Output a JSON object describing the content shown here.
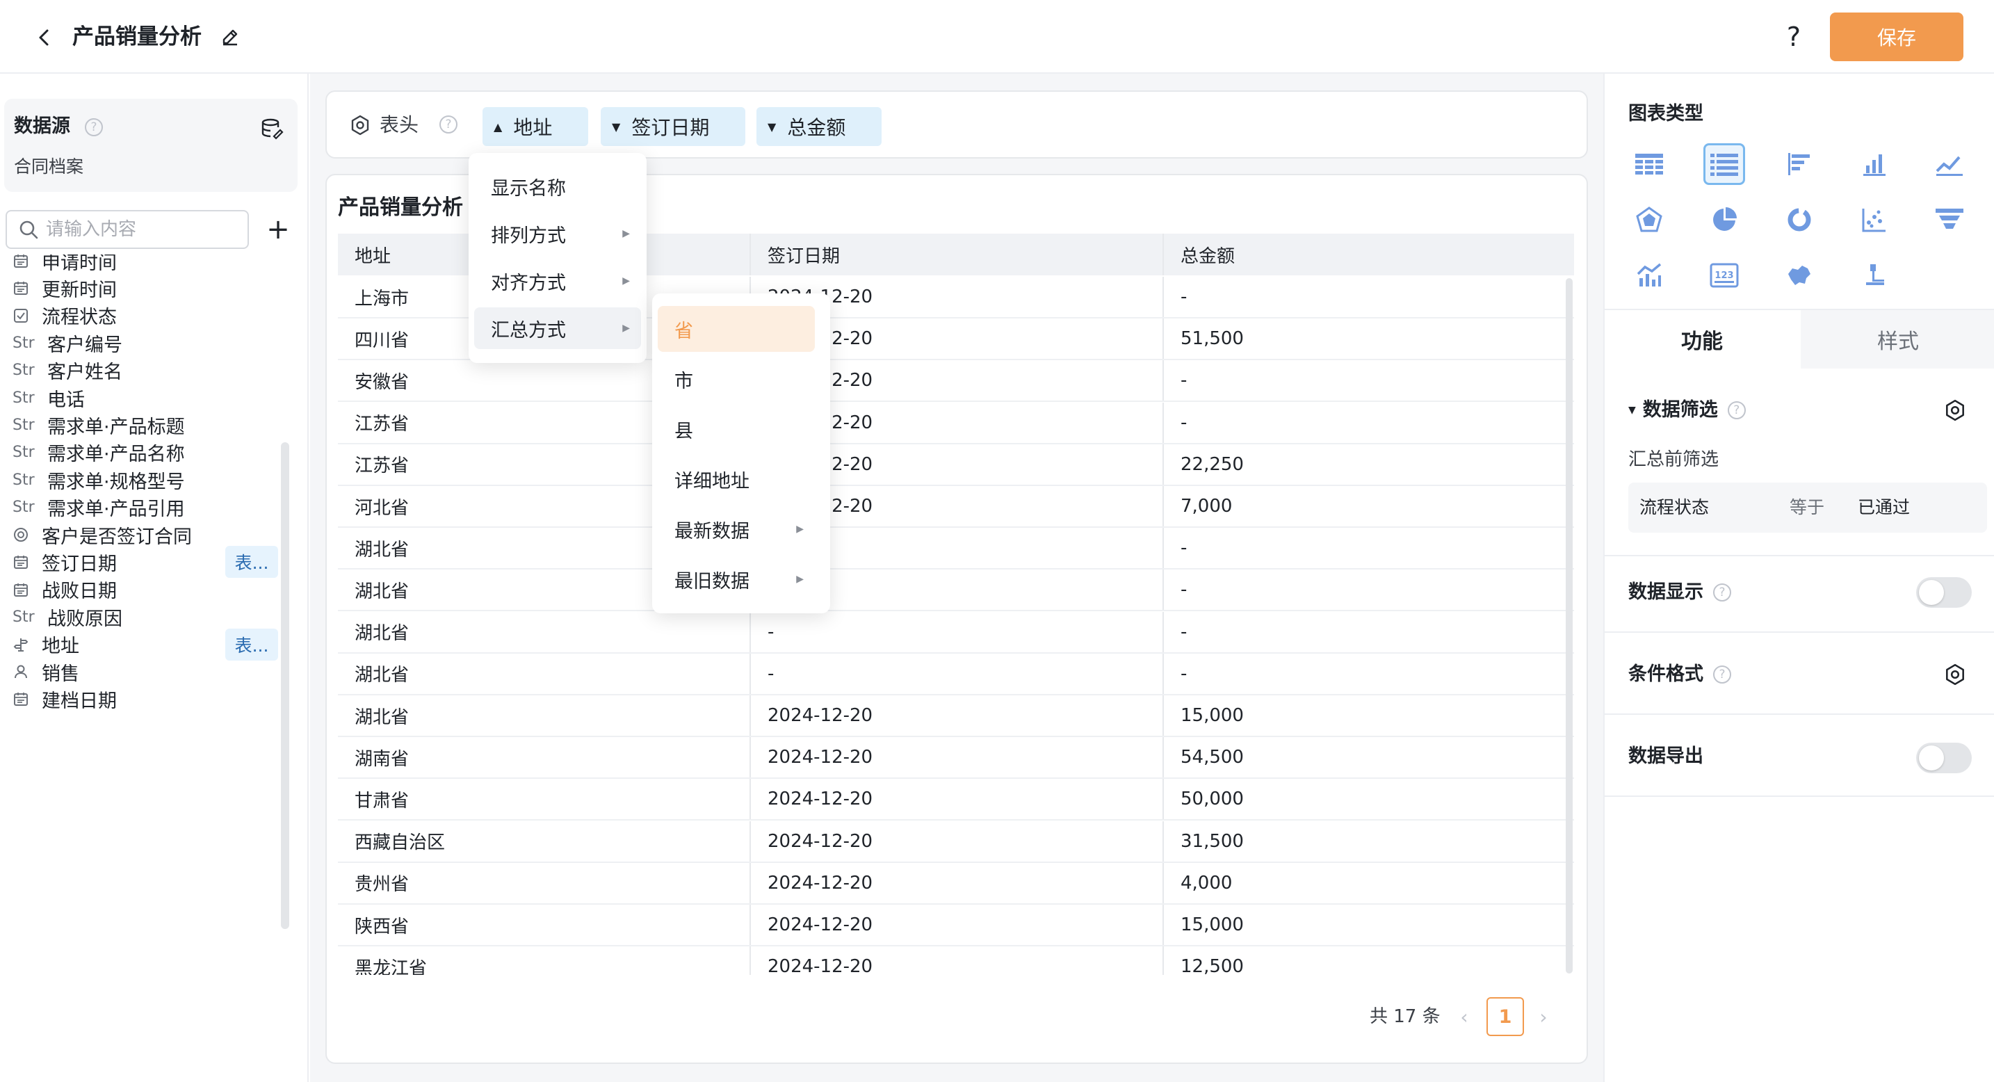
{
  "header": {
    "title": "产品销量分析",
    "help": "?",
    "save_label": "保存"
  },
  "datasource": {
    "title": "数据源",
    "help": "?",
    "name": "合同档案",
    "search_placeholder": "请输入内容",
    "add": "+"
  },
  "fields": [
    {
      "icon": "calendar-icon",
      "label": "申请时间",
      "type": "date"
    },
    {
      "icon": "calendar-icon",
      "label": "更新时间",
      "type": "date"
    },
    {
      "icon": "checkbox-icon",
      "label": "流程状态",
      "type": "check"
    },
    {
      "icon": "Str",
      "label": "客户编号",
      "type": "str"
    },
    {
      "icon": "Str",
      "label": "客户姓名",
      "type": "str"
    },
    {
      "icon": "Str",
      "label": "电话",
      "type": "str"
    },
    {
      "icon": "Str",
      "label": "需求单·产品标题",
      "type": "str"
    },
    {
      "icon": "Str",
      "label": "需求单·产品名称",
      "type": "str"
    },
    {
      "icon": "Str",
      "label": "需求单·规格型号",
      "type": "str"
    },
    {
      "icon": "Str",
      "label": "需求单·产品引用",
      "type": "str"
    },
    {
      "icon": "radio-icon",
      "label": "客户是否签订合同",
      "type": "radio"
    },
    {
      "icon": "calendar-icon",
      "label": "签订日期",
      "type": "date",
      "tag": "表..."
    },
    {
      "icon": "calendar-icon",
      "label": "战败日期",
      "type": "date"
    },
    {
      "icon": "Str",
      "label": "战败原因",
      "type": "str"
    },
    {
      "icon": "address-icon",
      "label": "地址",
      "type": "addr",
      "tag": "表..."
    },
    {
      "icon": "user-icon",
      "label": "销售",
      "type": "user"
    },
    {
      "icon": "calendar-icon",
      "label": "建档日期",
      "type": "date"
    }
  ],
  "header_bar": {
    "label": "表头",
    "help": "?",
    "chips": [
      {
        "label": "地址",
        "arrow": "▲"
      },
      {
        "label": "签订日期",
        "arrow": "▼"
      },
      {
        "label": "总金额",
        "arrow": "▼"
      }
    ]
  },
  "table": {
    "title": "产品销量分析",
    "columns": [
      "地址",
      "签订日期",
      "总金额"
    ],
    "rows": [
      [
        "上海市",
        "2024-12-20",
        "-"
      ],
      [
        "四川省",
        "2024-12-20",
        "51,500"
      ],
      [
        "安徽省",
        "2024-12-20",
        "-"
      ],
      [
        "江苏省",
        "2024-12-20",
        "-"
      ],
      [
        "江苏省",
        "2024-12-20",
        "22,250"
      ],
      [
        "河北省",
        "2024-12-20",
        "7,000"
      ],
      [
        "湖北省",
        "",
        "-"
      ],
      [
        "湖北省",
        "",
        "-"
      ],
      [
        "湖北省",
        "-",
        "-"
      ],
      [
        "湖北省",
        "-",
        "-"
      ],
      [
        "湖北省",
        "2024-12-20",
        "15,000"
      ],
      [
        "湖南省",
        "2024-12-20",
        "54,500"
      ],
      [
        "甘肃省",
        "2024-12-20",
        "50,000"
      ],
      [
        "西藏自治区",
        "2024-12-20",
        "31,500"
      ],
      [
        "贵州省",
        "2024-12-20",
        "4,000"
      ],
      [
        "陕西省",
        "2024-12-20",
        "15,000"
      ],
      [
        "黑龙江省",
        "2024-12-20",
        "12,500"
      ]
    ],
    "total": "共 17 条",
    "page": "1"
  },
  "menu1": [
    {
      "label": "显示名称",
      "sub": false
    },
    {
      "label": "排列方式",
      "sub": true
    },
    {
      "label": "对齐方式",
      "sub": true
    },
    {
      "label": "汇总方式",
      "sub": true
    }
  ],
  "menu2": [
    {
      "label": "省",
      "sub": false,
      "selected": true
    },
    {
      "label": "市",
      "sub": false
    },
    {
      "label": "县",
      "sub": false
    },
    {
      "label": "详细地址",
      "sub": false
    },
    {
      "label": "最新数据",
      "sub": true
    },
    {
      "label": "最旧数据",
      "sub": true
    }
  ],
  "right": {
    "chart_type_title": "图表类型",
    "chart_icons": [
      "table-icon",
      "detail-table-icon",
      "bar-horizontal-icon",
      "bar-vertical-icon",
      "line-icon",
      "radar-icon",
      "pie-icon",
      "donut-icon",
      "scatter-icon",
      "funnel-icon",
      "combo-icon",
      "number-card-icon",
      "map-icon",
      "tree-icon"
    ],
    "tab_function": "功能",
    "tab_style": "样式",
    "filter_section": "数据筛选",
    "filter_sub": "汇总前筛选",
    "filter_field": "流程状态",
    "filter_op": "等于",
    "filter_value": "已通过",
    "display_section": "数据显示",
    "condition_section": "条件格式",
    "export_section": "数据导出",
    "help": "?"
  },
  "colors": {
    "accent": "#f29a4e",
    "chip": "#dff0fb",
    "active_icon": "#7ab8ee"
  }
}
